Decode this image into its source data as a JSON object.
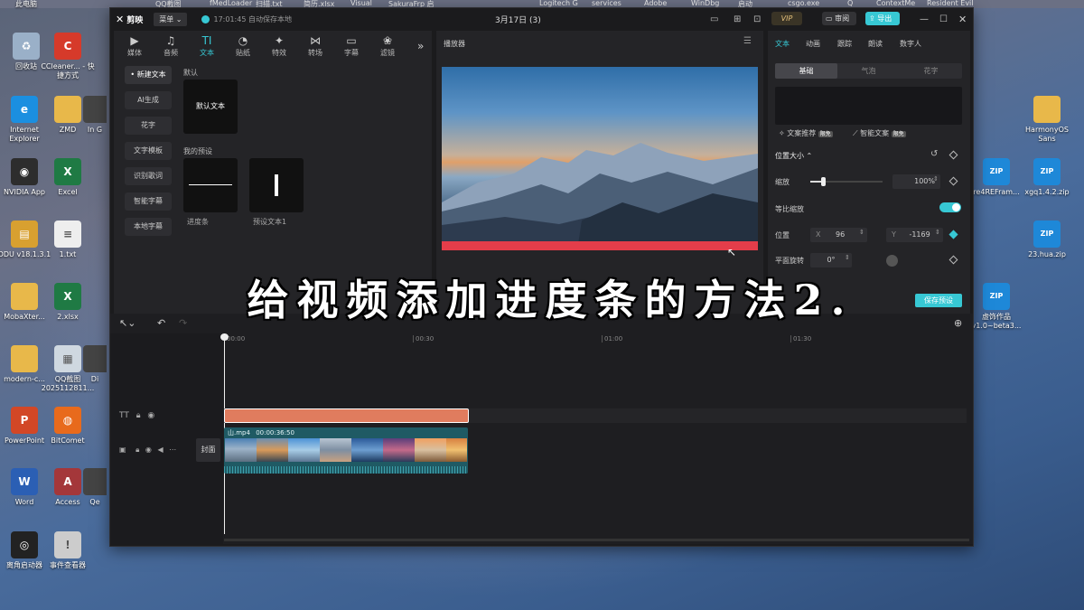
{
  "taskbar_strip": [
    "QQ截图",
    "fMedLoader",
    "扫描.txt",
    "简历.xlsx",
    "Visual",
    "SakuraFrp 启",
    "Logitech G",
    "services",
    "Adobe",
    "WinDbg",
    "启动",
    "csgo.exe",
    "Q",
    "ContextMe",
    "Resident Evil"
  ],
  "desktop_left": [
    {
      "label": "此电脑",
      "icon": "computer-icon",
      "color": "#4a80c8"
    },
    {
      "label": "回收站",
      "icon": "recycle-bin-icon",
      "color": "#9ab0c8"
    },
    {
      "label": "CCleaner... - 快捷方式",
      "icon": "ccleaner-icon",
      "color": "#d63a2a"
    },
    {
      "label": "Internet Explorer",
      "icon": "ie-icon",
      "color": "#1b8fe0"
    },
    {
      "label": "ZMD",
      "icon": "folder-icon",
      "color": "#e8b84a"
    },
    {
      "label": "In G",
      "icon": "app-icon",
      "color": "#444"
    },
    {
      "label": "NVIDIA App",
      "icon": "nvidia-icon",
      "color": "#2d2d2d"
    },
    {
      "label": "Excel",
      "icon": "excel-icon",
      "color": "#1f7a44"
    },
    {
      "label": "DDU v18.1.3.1",
      "icon": "ddu-icon",
      "color": "#d8a030"
    },
    {
      "label": "1.txt",
      "icon": "txt-icon",
      "color": "#eee"
    },
    {
      "label": "MobaXter...",
      "icon": "folder-icon",
      "color": "#e8b84a"
    },
    {
      "label": "2.xlsx",
      "icon": "xlsx-icon",
      "color": "#1f7a44"
    },
    {
      "label": "modern-c...",
      "icon": "folder-icon",
      "color": "#e8b84a"
    },
    {
      "label": "QQ截图 2025112811...",
      "icon": "image-icon",
      "color": "#cfd8e0"
    },
    {
      "label": "Di",
      "icon": "app-icon",
      "color": "#444"
    },
    {
      "label": "PowerPoint",
      "icon": "powerpoint-icon",
      "color": "#d24726"
    },
    {
      "label": "BitComet",
      "icon": "bitcomet-icon",
      "color": "#e86a1c"
    },
    {
      "label": "Word",
      "icon": "word-icon",
      "color": "#2b5fb4"
    },
    {
      "label": "Access",
      "icon": "access-icon",
      "color": "#a4373a"
    },
    {
      "label": "Qe",
      "icon": "app-icon",
      "color": "#444"
    },
    {
      "label": "离角启动器",
      "icon": "launcher-icon",
      "color": "#222"
    },
    {
      "label": "事件查看器",
      "icon": "event-viewer-icon",
      "color": "#ccc"
    }
  ],
  "desktop_right": [
    {
      "label": "HarmonyOS Sans",
      "icon": "folder-icon",
      "color": "#e8b84a"
    },
    {
      "label": "re4REFram...",
      "icon": "zip-icon",
      "color": "#1e88d8"
    },
    {
      "label": "xgq1.4.2.zip",
      "icon": "zip-icon",
      "color": "#1e88d8"
    },
    {
      "label": "23.hua.zip",
      "icon": "zip-icon",
      "color": "#1e88d8"
    },
    {
      "label": "虚饰作品 v1.0~beta3...",
      "icon": "zip-icon",
      "color": "#1e88d8"
    }
  ],
  "app": {
    "logo": "剪映",
    "menu_label": "菜单",
    "autosave": "17:01:45 自动保存本地",
    "project_title": "3月17日 (3)",
    "vip": "VIP",
    "review": "审阅",
    "export": "导出"
  },
  "toolbar": [
    {
      "label": "媒体",
      "icon": "▶"
    },
    {
      "label": "音频",
      "icon": "♫"
    },
    {
      "label": "文本",
      "icon": "TI"
    },
    {
      "label": "贴纸",
      "icon": "◔"
    },
    {
      "label": "特效",
      "icon": "✦"
    },
    {
      "label": "转场",
      "icon": "⋈"
    },
    {
      "label": "字幕",
      "icon": "▭"
    },
    {
      "label": "滤镜",
      "icon": "❀"
    }
  ],
  "text_sidebar": [
    "• 新建文本",
    "AI生成",
    "花字",
    "文字模板",
    "识别歌词",
    "智能字幕",
    "本地字幕"
  ],
  "text_panel": {
    "default_section": "默认",
    "default_card": "默认文本",
    "presets_section": "我的预设",
    "preset1": "进度条",
    "preset2": "预设文本1"
  },
  "player": {
    "title": "播放器"
  },
  "inspector": {
    "tabs": [
      "文本",
      "动画",
      "跟踪",
      "朗读",
      "数字人"
    ],
    "subtabs": [
      "基础",
      "气泡",
      "花字"
    ],
    "text_recommend": "文案推荐",
    "smart_text": "智能文案",
    "badge": "限免",
    "section": "位置大小",
    "scale_label": "缩放",
    "scale_value": "100%",
    "scale_level": 0.08,
    "uniform_label": "等比缩放",
    "position_label": "位置",
    "x_label": "X",
    "x_value": "96",
    "y_label": "Y",
    "y_value": "-1169",
    "rotate_label": "平面旋转",
    "rotate_value": "0°",
    "save_preset": "保存预设"
  },
  "timeline": {
    "ruler": [
      "00:00",
      "00:30",
      "01:00",
      "01:30"
    ],
    "clip_name": "山.mp4",
    "clip_duration": "00:00:36:50",
    "cover_label": "封面"
  },
  "overlay_caption": "给视频添加进度条的方法2."
}
